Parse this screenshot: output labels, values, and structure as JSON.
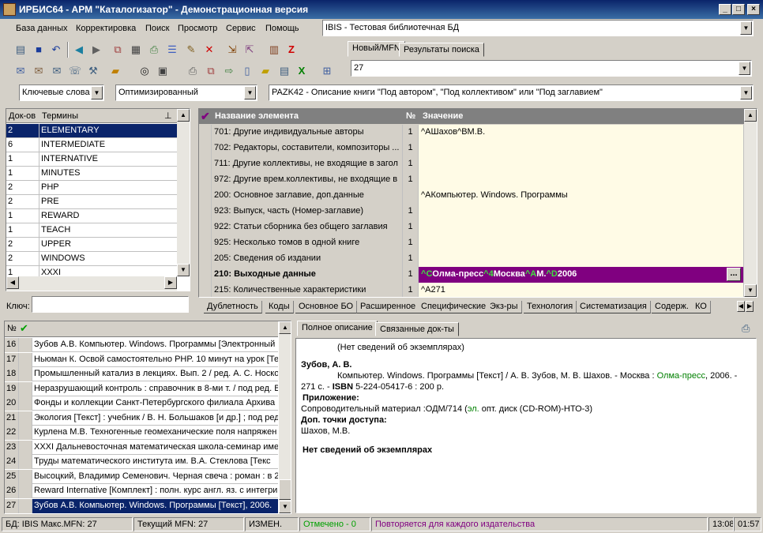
{
  "window": {
    "title": "ИРБИС64 - АРМ \"Каталогизатор\" - Демонстрационная версия",
    "minimize": "_",
    "maximize": "□",
    "close": "×"
  },
  "menu": [
    "База данных",
    "Корректировка",
    "Поиск",
    "Просмотр",
    "Сервис",
    "Помощь"
  ],
  "db_combo": "IBIS - Тестовая библиотечная БД",
  "tabs_top": [
    "Новый/MFN",
    "Результаты поиска"
  ],
  "mfn_value": "27",
  "search_type": "Ключевые слова",
  "opt_combo": "Оптимизированный",
  "worksheet_combo": "PAZK42 - Описание книги \"Под автором\", \"Под коллективом\" или \"Под заглавием\"",
  "terms": {
    "headers": [
      "Док-ов",
      "Термины"
    ],
    "rows": [
      [
        "2",
        "ELEMENTARY"
      ],
      [
        "6",
        "INTERMEDIATE"
      ],
      [
        "1",
        "INTERNATIVE"
      ],
      [
        "1",
        "MINUTES"
      ],
      [
        "2",
        "PHP"
      ],
      [
        "2",
        "PRE"
      ],
      [
        "1",
        "REWARD"
      ],
      [
        "1",
        "TEACH"
      ],
      [
        "2",
        "UPPER"
      ],
      [
        "2",
        "WINDOWS"
      ],
      [
        "1",
        "XXXI"
      ]
    ],
    "key_label": "Ключ:"
  },
  "fields": {
    "headers": [
      "Название элемента",
      "№",
      "Значение"
    ],
    "rows": [
      {
        "name": "701: Другие индивидуальные авторы",
        "n": "1",
        "val": "^AШахов^BМ.В."
      },
      {
        "name": "702: Редакторы, составители, композиторы ...",
        "n": "1",
        "val": ""
      },
      {
        "name": "711: Другие коллективы, не входящие в загол",
        "n": "1",
        "val": ""
      },
      {
        "name": "972: Другие врем.коллективы, не входящие в",
        "n": "1",
        "val": ""
      },
      {
        "name": "200: Основное заглавие, доп.данные",
        "n": "",
        "val": "^AКомпьютер. Windows. Программы"
      },
      {
        "name": "923: Выпуск, часть (Номер-заглавие)",
        "n": "1",
        "val": ""
      },
      {
        "name": "922: Статьи сборника без общего заглавия",
        "n": "1",
        "val": ""
      },
      {
        "name": "925: Несколько томов в одной книге",
        "n": "1",
        "val": ""
      },
      {
        "name": "205: Сведения об издании",
        "n": "1",
        "val": ""
      },
      {
        "name": "210: Выходные данные",
        "n": "1",
        "val": "^CОлма-пресс^4Москва^AМ.^D2006"
      },
      {
        "name": "215: Количественные характеристики",
        "n": "1",
        "val": "^A271"
      }
    ],
    "edit_btn": "...",
    "sel_val_parts": [
      [
        "^",
        "g"
      ],
      [
        "C",
        "g"
      ],
      [
        "Олма-пресс",
        "w"
      ],
      [
        "^",
        "g"
      ],
      [
        "4",
        "g"
      ],
      [
        "Москва",
        "w"
      ],
      [
        "^",
        "g"
      ],
      [
        "A",
        "g"
      ],
      [
        "М.",
        "w"
      ],
      [
        "^",
        "g"
      ],
      [
        "D",
        "g"
      ],
      [
        "2006",
        "w"
      ]
    ]
  },
  "bottom_tabs": [
    "Дублетность",
    "Коды",
    "Основное БО",
    "Расширенное",
    "Специфические",
    "Экз-ры",
    "Технология",
    "Систематизация",
    "Содерж.",
    "КО"
  ],
  "records": {
    "headers": [
      "№",
      "✔"
    ],
    "rows": [
      [
        "16",
        "Зубов А.В. Компьютер. Windows. Программы [Электронный"
      ],
      [
        "17",
        "Ньюман К. Освой самостоятельно PHP. 10 минут на урок [Те"
      ],
      [
        "18",
        "Промышленный катализ в лекциях. Вып. 2 / ред. А. С. Носко"
      ],
      [
        "19",
        "Неразрушающий контроль : справочник в 8-ми т. / под ред. В"
      ],
      [
        "20",
        "Фонды и коллекции Санкт-Петербургского филиала Архива Р"
      ],
      [
        "21",
        "Экология [Текст] : учебник / В. Н. Большаков [и др.] ; под ред"
      ],
      [
        "22",
        "Курлена М.В. Техногенные геомеханические поля напряжен"
      ],
      [
        "23",
        "XXXI Дальневосточная математическая школа-семинар име"
      ],
      [
        "24",
        "Труды математического института им. В.А. Стеклова [Текс"
      ],
      [
        "25",
        "Высоцкий, Владимир Семенович. Черная свеча : роман : в 2"
      ],
      [
        "26",
        "Reward Internative [Комплект] : полн. курс англ. яз. с интегри"
      ],
      [
        "27",
        "Зубов А.В. Компьютер. Windows. Программы [Текст], 2006."
      ]
    ]
  },
  "desc_tabs": [
    "Полное описание",
    "Связанные док-ты"
  ],
  "desc": {
    "line1": "(Нет сведений об экземплярах)",
    "author": "Зубов, А. В.",
    "body_a": "Компьютер. Windows. Программы [Текст] / А. В. Зубов, М. В. Шахов. - Москва : ",
    "publisher": "Олма-пресс",
    "body_b": ", 2006. -",
    "body_c": "271 с. - ",
    "isbn_label": "ISBN",
    "isbn": " 5-224-05417-6 : 200 р.",
    "app_label": "Приложение:",
    "app_a": "Сопроводительный материал :ОДМ/714 (",
    "app_el": "эл.",
    "app_b": " опт. диск (CD-ROM)-НТО-3)",
    "access_label": "Доп. точки доступа:",
    "access": "Шахов, М.В.",
    "no_copies": "Нет сведений об экземплярах"
  },
  "status": {
    "db": "БД: IBIS Макс.MFN: 27",
    "cur": "Текущий MFN: 27",
    "mod": "ИЗМЕН.",
    "marked": "Отмечено - 0",
    "msg": "Повторяется для каждого издательства",
    "time": "13:08",
    "elapsed": "01:57"
  },
  "colors": {
    "selection": "#0a246a",
    "highlight_row": "#800080",
    "field_bg": "#fffbe6",
    "green": "#00a000",
    "purple": "#800080"
  }
}
